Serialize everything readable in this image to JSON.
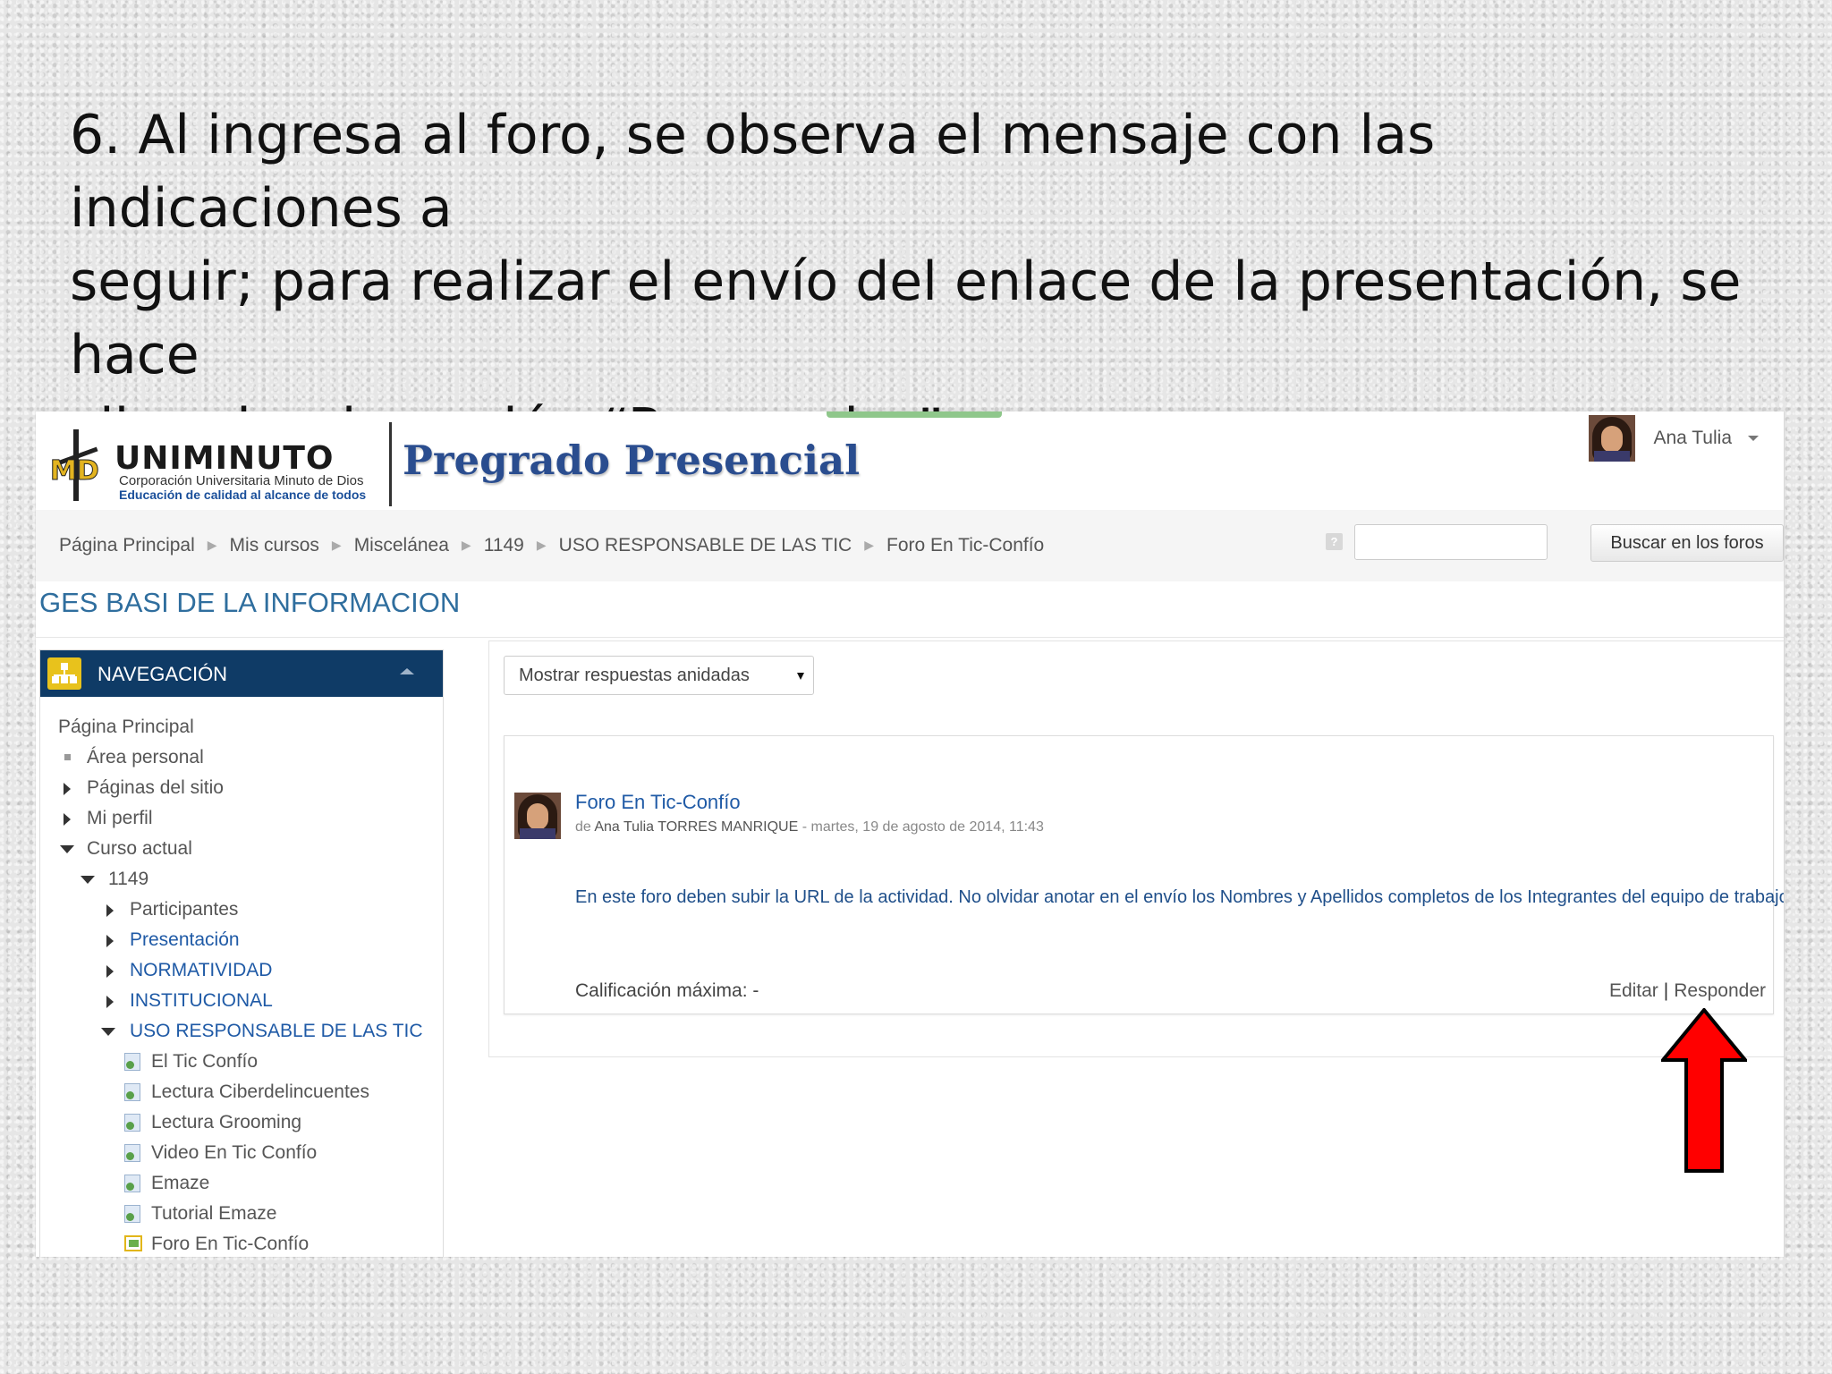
{
  "instruction": {
    "line1": "6. Al ingresa al foro, se observa el mensaje con las indicaciones a",
    "line2": "seguir; para realizar el envío del enlace de la presentación, se hace",
    "line3": "clic sobre  la opción “Responder”."
  },
  "header": {
    "logo_name": "UNIMINUTO",
    "logo_line1": "Corporación Universitaria Minuto de Dios",
    "logo_line2": "Educación de calidad al alcance de todos",
    "site_title": "Pregrado Presencial",
    "user_name": "Ana Tulia"
  },
  "breadcrumb": [
    "Página Principal",
    "Mis cursos",
    "Miscelánea",
    "1149",
    "USO RESPONSABLE DE LAS TIC",
    "Foro En Tic-Confío"
  ],
  "search": {
    "placeholder": "",
    "button": "Buscar en los foros",
    "help_icon": "?"
  },
  "course_title": "GES BASI DE LA INFORMACION",
  "nav": {
    "title": "NAVEGACIÓN",
    "items": [
      "Página Principal",
      "Área personal",
      "Páginas del sitio",
      "Mi perfil",
      "Curso actual",
      "1149",
      "Participantes",
      "Presentación",
      "NORMATIVIDAD",
      "INSTITUCIONAL",
      "USO RESPONSABLE DE LAS TIC",
      "El Tic Confío",
      "Lectura Ciberdelincuentes",
      "Lectura Grooming",
      "Video En Tic Confío",
      "Emaze",
      "Tutorial Emaze",
      "Foro En Tic-Confío"
    ]
  },
  "display_mode": "Mostrar respuestas anidadas",
  "post": {
    "subject": "Foro En Tic-Confío",
    "author_prefix": "de",
    "author": "Ana Tulia TORRES MANRIQUE",
    "date": "- martes, 19 de agosto de 2014, 11:43",
    "body": "En este foro deben subir la URL de la actividad. No olvidar anotar en el envío los Nombres y Apellidos completos de los Integrantes del equipo de trabajo.",
    "grade": "Calificación máxima: -",
    "edit": "Editar",
    "separator": "|",
    "reply": "Responder"
  },
  "colors": {
    "nav_header": "#0f3b66",
    "link": "#1f5aa6",
    "accent_arrow": "#ff0000"
  }
}
